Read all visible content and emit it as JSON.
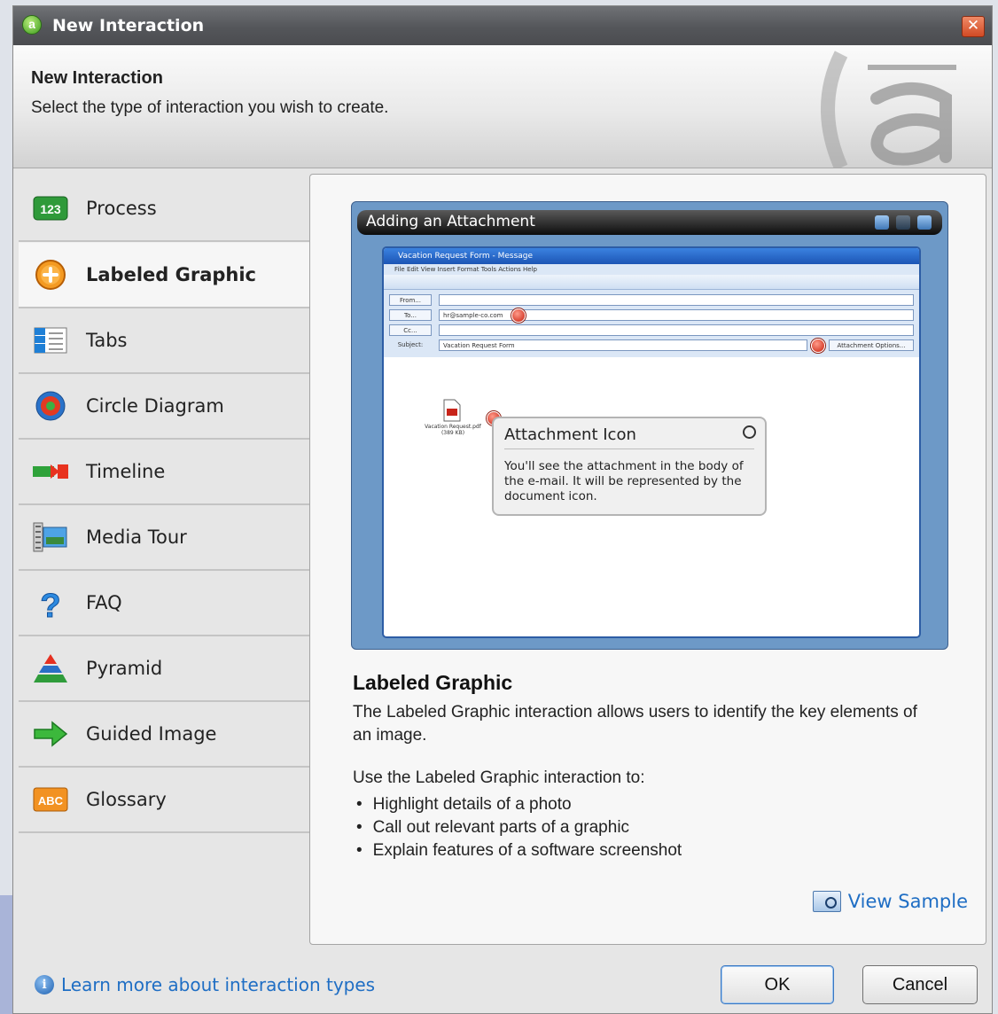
{
  "window": {
    "title": "New Interaction",
    "app_icon_letter": "a"
  },
  "header": {
    "title": "New Interaction",
    "subtitle": "Select the type of interaction you wish to create."
  },
  "sidebar": {
    "items": [
      {
        "label": "Process",
        "icon": "process-123-icon",
        "icon_text": "123",
        "selected": false
      },
      {
        "label": "Labeled Graphic",
        "icon": "labeled-graphic-plus-icon",
        "selected": true
      },
      {
        "label": "Tabs",
        "icon": "tabs-icon",
        "selected": false
      },
      {
        "label": "Circle Diagram",
        "icon": "circle-diagram-icon",
        "selected": false
      },
      {
        "label": "Timeline",
        "icon": "timeline-icon",
        "selected": false
      },
      {
        "label": "Media Tour",
        "icon": "media-tour-icon",
        "selected": false
      },
      {
        "label": "FAQ",
        "icon": "faq-question-icon",
        "selected": false
      },
      {
        "label": "Pyramid",
        "icon": "pyramid-icon",
        "selected": false
      },
      {
        "label": "Guided Image",
        "icon": "guided-image-arrow-icon",
        "selected": false
      },
      {
        "label": "Glossary",
        "icon": "glossary-abc-icon",
        "icon_text": "ABC",
        "selected": false
      }
    ]
  },
  "preview": {
    "title": "Adding an Attachment",
    "mail": {
      "window_title": "Vacation Request Form - Message",
      "menu": "File  Edit  View  Insert  Format  Tools  Actions  Help",
      "fields": {
        "from_label": "From...",
        "to_label": "To...",
        "to_value": "hr@sample-co.com",
        "cc_label": "Cc...",
        "subject_label": "Subject:",
        "subject_value": "Vacation Request Form",
        "attachment_options": "Attachment Options..."
      },
      "attachment_caption": "Vacation Request.pdf (389 KB)"
    },
    "callout": {
      "title": "Attachment Icon",
      "body": "You'll see the attachment in the body of the e-mail.  It will be represented by the document icon."
    }
  },
  "description": {
    "title": "Labeled Graphic",
    "text": "The Labeled Graphic interaction allows users to identify the key elements of an image.",
    "intro": "Use the Labeled Graphic interaction to:",
    "bullets": [
      "Highlight details of a photo",
      "Call out relevant parts of a graphic",
      "Explain features of a software screenshot"
    ],
    "view_sample": "View Sample"
  },
  "footer": {
    "learn_more": "Learn more about interaction types",
    "ok": "OK",
    "cancel": "Cancel"
  },
  "colors": {
    "link": "#1f6ec4",
    "titlebar": "#54565a",
    "close": "#d14a24",
    "selected_item_bg": "#f6f6f6"
  }
}
